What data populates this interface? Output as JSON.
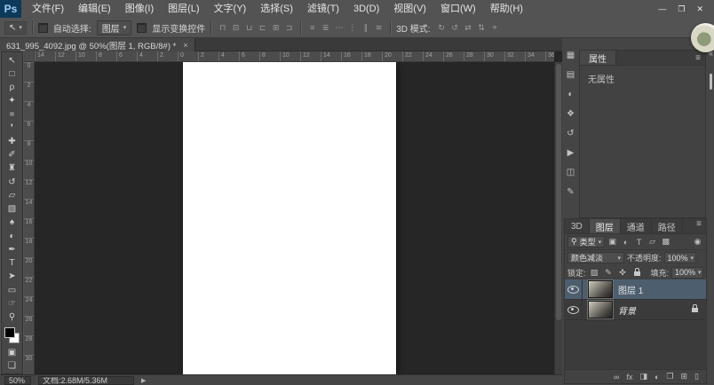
{
  "window": {
    "logo": "Ps",
    "controls": {
      "minimize": "—",
      "maximize": "❐",
      "close": "✕"
    }
  },
  "colors": {
    "logo_bg": "#0d3a5a",
    "logo_text": "#9fd1f7",
    "selected_layer_row": "#4d5e6f",
    "canvas_background": "#262626"
  },
  "menubar": {
    "items": [
      {
        "label": "文件(F)"
      },
      {
        "label": "编辑(E)"
      },
      {
        "label": "图像(I)"
      },
      {
        "label": "图层(L)"
      },
      {
        "label": "文字(Y)"
      },
      {
        "label": "选择(S)"
      },
      {
        "label": "滤镜(T)"
      },
      {
        "label": "3D(D)"
      },
      {
        "label": "视图(V)"
      },
      {
        "label": "窗口(W)"
      },
      {
        "label": "帮助(H)"
      }
    ]
  },
  "options_bar": {
    "tool_icon": "↖",
    "auto_select_label": "自动选择:",
    "auto_select_value": "图层",
    "show_transform_label": "显示变换控件",
    "align_icons": [
      {
        "name": "align-top-icon",
        "glyph": "⊓"
      },
      {
        "name": "align-vcenter-icon",
        "glyph": "⊟"
      },
      {
        "name": "align-bottom-icon",
        "glyph": "⊔"
      },
      {
        "name": "align-left-icon",
        "glyph": "⊏"
      },
      {
        "name": "align-hcenter-icon",
        "glyph": "⊞"
      },
      {
        "name": "align-right-icon",
        "glyph": "⊐"
      }
    ],
    "distribute_icons": [
      {
        "name": "distribute-top-icon",
        "glyph": "≡"
      },
      {
        "name": "distribute-vcenter-icon",
        "glyph": "≣"
      },
      {
        "name": "distribute-bottom-icon",
        "glyph": "⋯"
      },
      {
        "name": "distribute-left-icon",
        "glyph": "⋮"
      },
      {
        "name": "distribute-hcenter-icon",
        "glyph": "∥"
      },
      {
        "name": "distribute-right-icon",
        "glyph": "≋"
      }
    ],
    "mode_label": "3D 模式:",
    "mode_icons": [
      {
        "name": "3d-rotate-icon",
        "glyph": "↻"
      },
      {
        "name": "3d-roll-icon",
        "glyph": "↺"
      },
      {
        "name": "3d-drag-icon",
        "glyph": "⇄"
      },
      {
        "name": "3d-slide-icon",
        "glyph": "⇅"
      },
      {
        "name": "3d-scale-icon",
        "glyph": "⌖"
      }
    ]
  },
  "document_tab": {
    "title": "631_995_4092.jpg @ 50%(图层 1, RGB/8#) *",
    "close_icon": "×"
  },
  "rulers": {
    "horizontal": [
      "14",
      "12",
      "10",
      "8",
      "6",
      "4",
      "2",
      "0",
      "2",
      "4",
      "6",
      "8",
      "10",
      "12",
      "14",
      "16",
      "18",
      "20",
      "22",
      "24",
      "26",
      "28",
      "30",
      "32",
      "34",
      "36"
    ],
    "vertical": [
      "0",
      "2",
      "4",
      "6",
      "8",
      "10",
      "12",
      "14",
      "16",
      "18",
      "20",
      "22",
      "24",
      "26",
      "28",
      "30"
    ]
  },
  "toolbox": {
    "tools": [
      {
        "name": "move-tool",
        "glyph": "↖"
      },
      {
        "name": "marquee-tool",
        "glyph": "□"
      },
      {
        "name": "lasso-tool",
        "glyph": "ρ"
      },
      {
        "name": "quick-selection-tool",
        "glyph": "✦"
      },
      {
        "name": "crop-tool",
        "glyph": "⌗"
      },
      {
        "name": "eyedropper-tool",
        "glyph": "❜"
      },
      {
        "name": "healing-brush-tool",
        "glyph": "✚"
      },
      {
        "name": "brush-tool",
        "glyph": "✐"
      },
      {
        "name": "clone-stamp-tool",
        "glyph": "♜"
      },
      {
        "name": "history-brush-tool",
        "glyph": "↺"
      },
      {
        "name": "eraser-tool",
        "glyph": "▱"
      },
      {
        "name": "gradient-tool",
        "glyph": "▧"
      },
      {
        "name": "blur-tool",
        "glyph": "♠"
      },
      {
        "name": "dodge-tool",
        "glyph": "◐"
      },
      {
        "name": "pen-tool",
        "glyph": "✒"
      },
      {
        "name": "type-tool",
        "glyph": "T"
      },
      {
        "name": "path-selection-tool",
        "glyph": "➤"
      },
      {
        "name": "shape-tool",
        "glyph": "▭"
      },
      {
        "name": "hand-tool",
        "glyph": "☞"
      },
      {
        "name": "zoom-tool",
        "glyph": "⚲"
      }
    ],
    "foreground_color": "#000000",
    "background_color": "#ffffff",
    "bottom_tools": [
      {
        "name": "quick-mask-icon",
        "glyph": "▣"
      },
      {
        "name": "screen-mode-icon",
        "glyph": "❏"
      }
    ]
  },
  "dock": {
    "expand_icon": "«",
    "strip_icons": [
      {
        "name": "color-panel-icon",
        "glyph": "▦"
      },
      {
        "name": "swatches-panel-icon",
        "glyph": "▤"
      },
      {
        "name": "adjustments-panel-icon",
        "glyph": "◐"
      },
      {
        "name": "styles-panel-icon",
        "glyph": "❖"
      },
      {
        "name": "history-panel-icon",
        "glyph": "↺"
      },
      {
        "name": "actions-panel-icon",
        "glyph": "▶"
      },
      {
        "name": "channels-panel-icon",
        "glyph": "◫"
      },
      {
        "name": "notes-panel-icon",
        "glyph": "✎"
      }
    ],
    "properties": {
      "tab_label": "属性",
      "menu_icon": "≡",
      "empty_text": "无属性"
    },
    "layers": {
      "tabs": [
        {
          "label": "3D"
        },
        {
          "label": "图层",
          "active": true
        },
        {
          "label": "通道"
        },
        {
          "label": "路径"
        }
      ],
      "menu_icon": "≡",
      "filter": {
        "search_icon": "⚲",
        "label": "类型",
        "icons": [
          {
            "name": "filter-pixel-layers-icon",
            "glyph": "▣"
          },
          {
            "name": "filter-adjustment-layers-icon",
            "glyph": "◐"
          },
          {
            "name": "filter-type-layers-icon",
            "glyph": "T"
          },
          {
            "name": "filter-shape-layers-icon",
            "glyph": "▱"
          },
          {
            "name": "filter-smart-objects-icon",
            "glyph": "▩"
          }
        ],
        "toggle_icon": "◉"
      },
      "blend_mode_value": "颜色减淡",
      "opacity_label": "不透明度:",
      "opacity_value": "100%",
      "lock_label": "锁定:",
      "lock_icons": [
        {
          "name": "lock-transparent-pixels-icon",
          "glyph": "▨"
        },
        {
          "name": "lock-image-pixels-icon",
          "glyph": "✎"
        },
        {
          "name": "lock-position-icon",
          "glyph": "✜"
        }
      ],
      "fill_label": "填充:",
      "fill_value": "100%",
      "rows": [
        {
          "name": "图层 1",
          "selected": true
        },
        {
          "name": "背景",
          "italic": true,
          "locked": true
        }
      ],
      "footer_icons": [
        {
          "name": "link-layers-icon",
          "glyph": "∞"
        },
        {
          "name": "layer-style-icon",
          "glyph": "fx"
        },
        {
          "name": "add-layer-mask-icon",
          "glyph": "◨"
        },
        {
          "name": "new-adjustment-layer-icon",
          "glyph": "◐"
        },
        {
          "name": "new-group-icon",
          "glyph": "❒"
        },
        {
          "name": "new-layer-icon",
          "glyph": "⊞"
        },
        {
          "name": "delete-layer-icon",
          "glyph": "▯"
        }
      ]
    }
  },
  "status_bar": {
    "zoom": "50%",
    "doc_info": "文档:2.68M/5.36M",
    "arrow_icon": "▶"
  },
  "icons": {
    "dropdown_arrow": "▾"
  }
}
